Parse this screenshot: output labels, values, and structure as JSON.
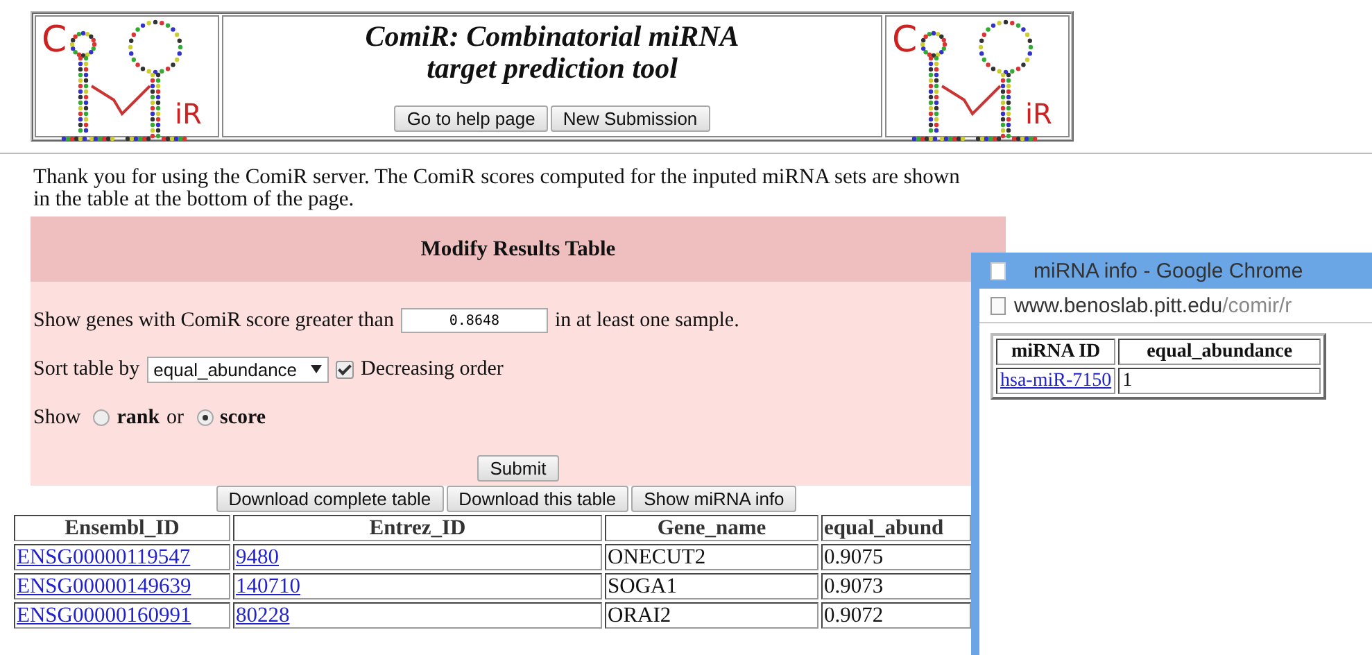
{
  "header": {
    "logos": [
      {
        "letters": [
          "C",
          "iR"
        ]
      },
      {
        "letters": [
          "C",
          "iR"
        ]
      }
    ],
    "title_lines": [
      "ComiR: Combinatorial miRNA",
      "target prediction tool"
    ],
    "buttons": [
      "Go to help page",
      "New Submission"
    ]
  },
  "intro": "Thank you for using the ComiR server. The ComiR scores computed for the inputed miRNA sets are shown in the table at the bottom of the page.",
  "modify_panel": {
    "title": "Modify Results Table",
    "threshold": {
      "label_before": "Show genes with ComiR score greater than",
      "value": "0.8648",
      "label_after": "in at least one sample."
    },
    "sort": {
      "label": "Sort table by",
      "value": "equal_abundance",
      "decreasing": {
        "label": "Decreasing order",
        "checked": true
      }
    },
    "show": {
      "label": "Show",
      "joiner": "or",
      "options": [
        {
          "label": "rank",
          "selected": false
        },
        {
          "label": "score",
          "selected": true
        }
      ]
    },
    "submit": "Submit"
  },
  "table_buttons": [
    "Download complete table",
    "Download this table",
    "Show miRNA info"
  ],
  "table": {
    "columns": [
      {
        "label": "Ensembl_ID",
        "kind": "link"
      },
      {
        "label": "Entrez_ID",
        "kind": "link"
      },
      {
        "label": "Gene_name",
        "kind": "text"
      },
      {
        "label": "equal_abund",
        "kind": "text"
      }
    ],
    "rows": [
      [
        "ENSG00000119547",
        "9480",
        "ONECUT2",
        "0.9075"
      ],
      [
        "ENSG00000149639",
        "140710",
        "SOGA1",
        "0.9073"
      ],
      [
        "ENSG00000160991",
        "80228",
        "ORAI2",
        "0.9072"
      ]
    ]
  },
  "popup": {
    "title": "miRNA info - Google Chrome",
    "url_host": "www.benoslab.pitt.edu",
    "url_path": "/comir/r",
    "table": {
      "columns": [
        "miRNA ID",
        "equal_abundance"
      ],
      "rows": [
        [
          "hsa-miR-7150",
          "1"
        ]
      ]
    }
  }
}
